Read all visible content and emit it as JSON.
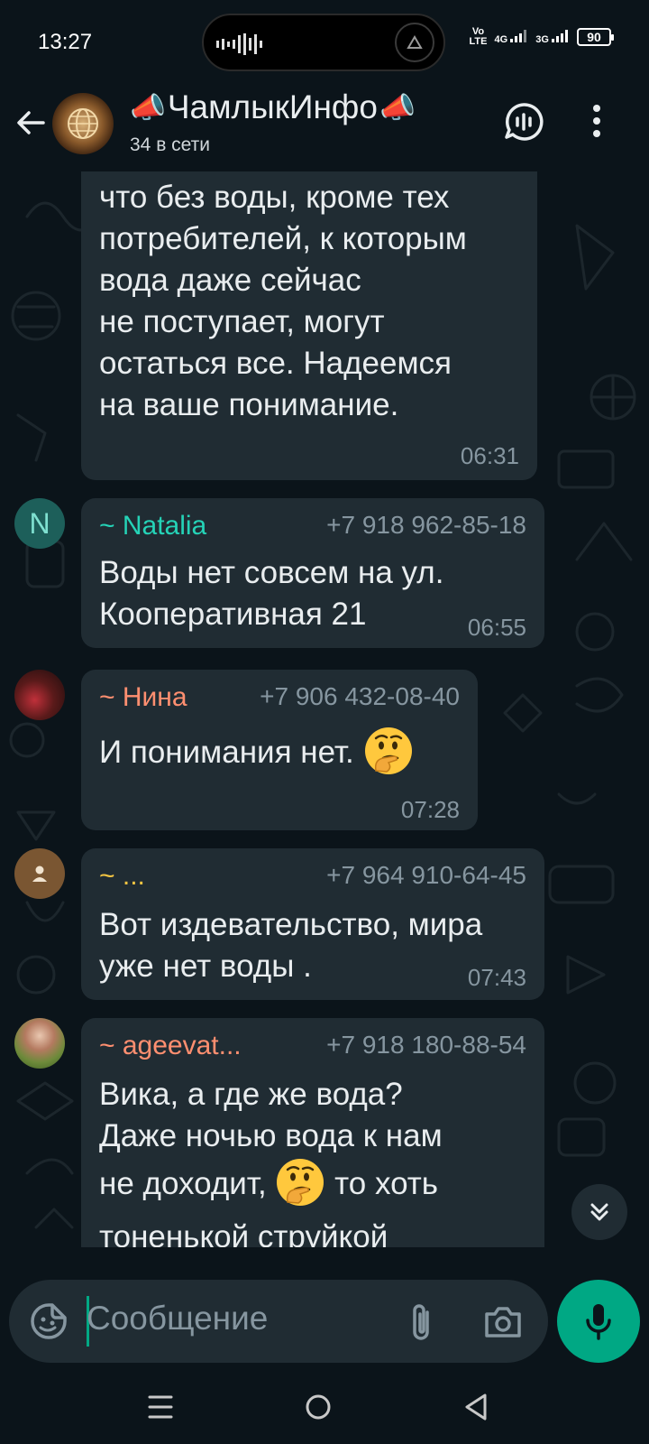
{
  "status_bar": {
    "time": "13:27",
    "sim1_label_top": "Vo",
    "sim1_label_bottom": "LTE",
    "network1": "4G",
    "network2": "3G",
    "battery": "90"
  },
  "header": {
    "title": "ЧамлыкИнфо",
    "subtitle": "34 в сети"
  },
  "messages": [
    {
      "continued": true,
      "lines": [
        "что без воды, кроме тех",
        "потребителей, к которым",
        "вода даже сейчас",
        "не поступает, могут",
        "остаться все. Надеемся",
        "на ваше понимание."
      ],
      "time": "06:31"
    },
    {
      "sender": "~ Natalia",
      "sender_color": "#25d3b7",
      "phone": "+7 918 962-85-18",
      "avatar_letter": "N",
      "lines": [
        "Воды нет совсем на ул.",
        "Кооперативная 21"
      ],
      "time": "06:55"
    },
    {
      "sender": "~ Нина",
      "sender_color": "#ff8f70",
      "phone": "+7 906 432-08-40",
      "line": "И понимания нет.",
      "emoji": "thinking-face",
      "time": "07:28"
    },
    {
      "sender": "~ ...",
      "sender_color": "#f5c542",
      "phone": "+7 964 910-64-45",
      "lines": [
        "Вот издевательство, мира",
        "уже нет воды ."
      ],
      "time": "07:43"
    },
    {
      "sender": "~ ageevat...",
      "sender_color": "#ff8f70",
      "phone": "+7 918 180-88-54",
      "line1": "Вика, а где же вода?",
      "line2": "Даже ночью вода к нам",
      "line3_before": "не доходит,",
      "line3_after": "то хоть",
      "line4": "тоненькой струйкой",
      "emoji": "thinking-face"
    }
  ],
  "composer": {
    "placeholder": "Сообщение"
  },
  "icons": [
    "back-arrow-icon",
    "voice-chat-icon",
    "more-options-icon",
    "sticker-icon",
    "attach-icon",
    "camera-icon",
    "mic-icon",
    "scroll-down-icon",
    "recents-icon",
    "home-icon",
    "nav-back-icon"
  ],
  "colors": {
    "background": "#0b141a",
    "bubble": "#202c33",
    "accent": "#00a884",
    "secondary_text": "#8696a0"
  }
}
